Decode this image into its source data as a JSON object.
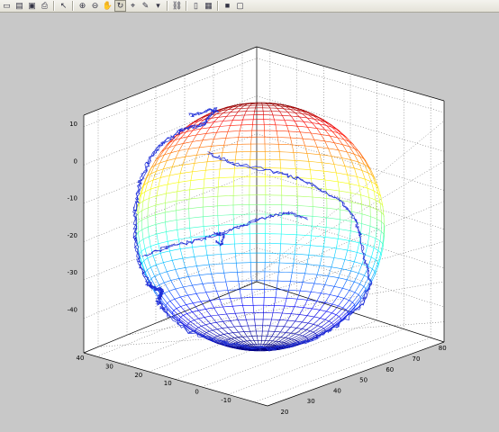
{
  "toolbar": {
    "items": [
      {
        "name": "new-figure-icon",
        "glyph": "▭"
      },
      {
        "name": "open-file-icon",
        "glyph": "▤"
      },
      {
        "name": "save-icon",
        "glyph": "▣"
      },
      {
        "name": "print-icon",
        "glyph": "⎙"
      },
      {
        "sep": true
      },
      {
        "name": "edit-plot-icon",
        "glyph": "↖"
      },
      {
        "sep": true
      },
      {
        "name": "zoom-in-icon",
        "glyph": "⊕"
      },
      {
        "name": "zoom-out-icon",
        "glyph": "⊖"
      },
      {
        "name": "pan-icon",
        "glyph": "✋"
      },
      {
        "name": "rotate-3d-icon",
        "glyph": "↻",
        "selected": true
      },
      {
        "name": "data-cursor-icon",
        "glyph": "⌖"
      },
      {
        "name": "brush-icon",
        "glyph": "✎"
      },
      {
        "name": "brush-dropdown-icon",
        "glyph": "▾"
      },
      {
        "sep": true
      },
      {
        "name": "link-plot-icon",
        "glyph": "⛓"
      },
      {
        "sep": true
      },
      {
        "name": "insert-colorbar-icon",
        "glyph": "▯"
      },
      {
        "name": "insert-legend-icon",
        "glyph": "▦"
      },
      {
        "sep": true
      },
      {
        "name": "hide-plot-tools-icon",
        "glyph": "■"
      },
      {
        "name": "show-plot-tools-icon",
        "glyph": "▢"
      }
    ]
  },
  "chart_data": {
    "type": "3d-surface-sphere",
    "title": "",
    "colormap": "jet",
    "grid": true,
    "x_axis": {
      "ticks": [
        "20",
        "30",
        "40",
        "50",
        "60",
        "70",
        "80"
      ]
    },
    "y_axis": {
      "ticks": [
        "40",
        "30",
        "20",
        "10",
        "0",
        "-10"
      ]
    },
    "z_axis": {
      "ticks": [
        "10",
        "0",
        "-10",
        "-20",
        "-30",
        "-40"
      ]
    },
    "series": [
      {
        "kind": "surface",
        "shape": "sphere wireframe",
        "color_by": "z"
      },
      {
        "kind": "line",
        "color": "#1f2fd8",
        "shape": "coastline / track on sphere"
      }
    ]
  }
}
